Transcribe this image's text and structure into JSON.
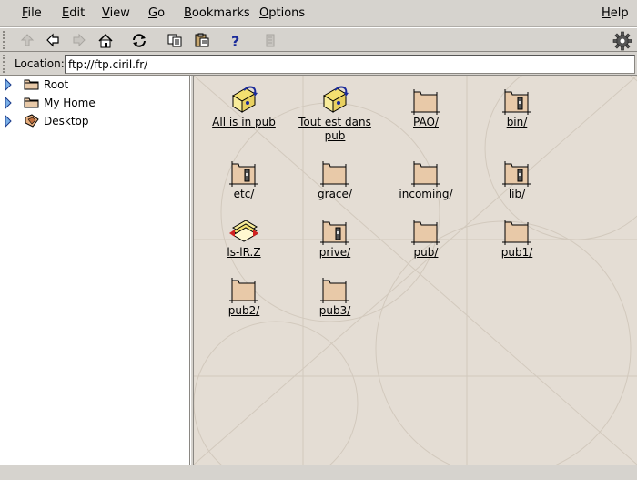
{
  "menubar": {
    "items": [
      {
        "label": "File"
      },
      {
        "label": "Edit"
      },
      {
        "label": "View"
      },
      {
        "label": "Go"
      },
      {
        "label": "Bookmarks"
      },
      {
        "label": "Options"
      }
    ],
    "help": "Help"
  },
  "toolbar": {
    "buttons": [
      {
        "icon": "up-arrow-icon",
        "enabled": false
      },
      {
        "icon": "back-arrow-icon",
        "enabled": true
      },
      {
        "icon": "forward-arrow-icon",
        "enabled": false
      },
      {
        "icon": "home-icon",
        "enabled": true
      },
      {
        "icon": "reload-icon",
        "enabled": true
      },
      {
        "icon": "copy-icon",
        "enabled": true
      },
      {
        "icon": "paste-icon",
        "enabled": true
      },
      {
        "icon": "help-icon",
        "enabled": true
      },
      {
        "icon": "stop-icon",
        "enabled": false
      }
    ]
  },
  "location": {
    "label": "Location:",
    "value": "ftp://ftp.ciril.fr/"
  },
  "sidebar": {
    "items": [
      {
        "label": "Root",
        "icon": "folder-icon"
      },
      {
        "label": "My Home",
        "icon": "folder-icon"
      },
      {
        "label": "Desktop",
        "icon": "desktop-icon"
      }
    ]
  },
  "files": [
    {
      "name": "All is in pub",
      "type": "link"
    },
    {
      "name": "Tout est dans pub",
      "type": "link"
    },
    {
      "name": "PAO/",
      "type": "folder"
    },
    {
      "name": "bin/",
      "type": "folder-locked"
    },
    {
      "name": "etc/",
      "type": "folder-locked"
    },
    {
      "name": "grace/",
      "type": "folder"
    },
    {
      "name": "incoming/",
      "type": "folder"
    },
    {
      "name": "lib/",
      "type": "folder-locked"
    },
    {
      "name": "ls-lR.Z",
      "type": "archive"
    },
    {
      "name": "prive/",
      "type": "folder-locked"
    },
    {
      "name": "pub/",
      "type": "folder"
    },
    {
      "name": "pub1/",
      "type": "folder"
    },
    {
      "name": "pub2/",
      "type": "folder"
    },
    {
      "name": "pub3/",
      "type": "folder"
    }
  ],
  "colors": {
    "chrome": "#d6d3ce",
    "content_bg": "#e4ddd4",
    "folder": "#e8c9a8",
    "help_blue": "#1a2a9a"
  }
}
